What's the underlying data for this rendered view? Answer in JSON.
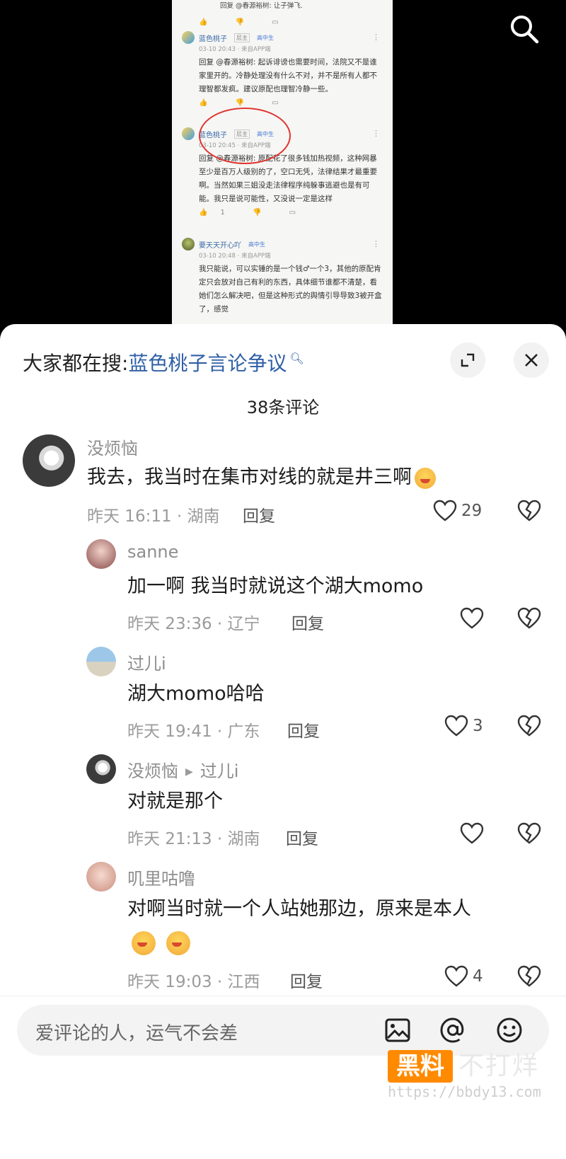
{
  "video": {
    "reply_top": "回复 @春源裕树:  让子弹飞.",
    "comments": [
      {
        "name": "蓝色桃子",
        "tag": "层主",
        "tag2": "高中生",
        "meta": "03-10 20:43 · 来自APP端",
        "text": "回复 @春源裕树:  起诉诽谤也需要时间，法院又不是谁家里开的。冷静处理没有什么不对，并不是所有人都不理智都发疯。建议原配也理智冷静一些。"
      },
      {
        "name": "蓝色桃子",
        "tag": "层主",
        "tag2": "高中生",
        "meta": "03-10 20:45 · 来自APP端",
        "text": "回复 @春源裕树:  原配花了很多钱加热视频，这种网暴至少是百万人级别的了，空口无凭，法律结果才最重要啊。当然如果三姐没走法律程序纯躲事逃避也是有可能。我只是说可能性，又没说一定是这样",
        "likes": "1"
      },
      {
        "name": "要天天开心吖",
        "tag2": "高中生",
        "meta": "03-10 20:48 · 来自APP端",
        "text": "我只能说，可以实锤的是一个钱♂一个3，其他的原配肯定只会放对自己有利的东西，具体细节谁都不清楚，看她们怎么解决吧，但是这种形式的舆情引导导致3被开盒了，感觉"
      }
    ]
  },
  "sheet": {
    "search_prefix": "大家都在搜:",
    "search_keyword": "蓝色桃子言论争议",
    "comment_count": "38条评论"
  },
  "comments": [
    {
      "name": "没烦恼",
      "text": "我去，我当时在集市对线的就是井三啊",
      "meta": "昨天 16:11 · 湖南",
      "reply": "回复",
      "likes": "29"
    },
    {
      "name": "sanne",
      "text": "加一啊 我当时就说这个湖大momo",
      "meta": "昨天 23:36 · 辽宁",
      "reply": "回复",
      "likes": ""
    },
    {
      "name": "过儿i",
      "text": "湖大momo哈哈",
      "meta": "昨天 19:41 · 广东",
      "reply": "回复",
      "likes": "3"
    },
    {
      "name": "没烦恼",
      "reply_to": "过儿i",
      "text": "对就是那个",
      "meta": "昨天 21:13 · 湖南",
      "reply": "回复",
      "likes": ""
    },
    {
      "name": "叽里咕噜",
      "text": "对啊当时就一个人站她那边，原来是本人",
      "meta": "昨天 19:03 · 江西",
      "reply": "回复",
      "likes": "4"
    }
  ],
  "input": {
    "placeholder": "爱评论的人，运气不会差"
  },
  "watermark": {
    "badge": "黑料",
    "text": "不打烊",
    "url": "https://bbdy13.com"
  },
  "colors": {
    "accent_link": "#2f5fa6",
    "watermark_orange": "#ff8a00",
    "annotation_red": "#e0332f"
  },
  "icons": [
    "search-icon",
    "expand-icon",
    "close-icon",
    "heart-icon",
    "broken-heart-icon",
    "image-icon",
    "at-icon",
    "emoji-icon"
  ]
}
